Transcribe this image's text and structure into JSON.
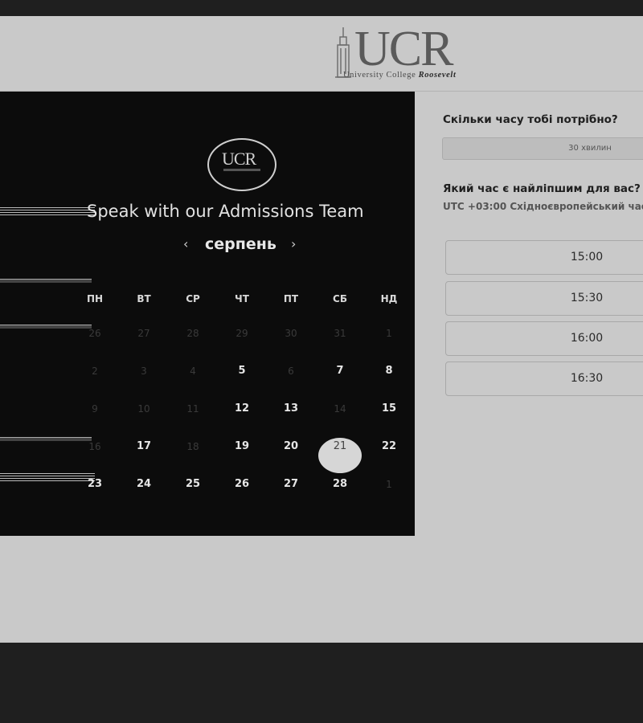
{
  "header": {
    "logo_text": "UCR",
    "logo_subtitle": "University College",
    "logo_subtitle_italic": "Roosevelt"
  },
  "scheduler": {
    "badge_text": "UCR",
    "title": "Speak with our Admissions Team",
    "month": "серпень",
    "prev_icon": "‹",
    "next_icon": "›",
    "weekdays": [
      "ПН",
      "ВТ",
      "СР",
      "ЧТ",
      "ПТ",
      "СБ",
      "НД"
    ],
    "weeks": [
      [
        {
          "d": "26",
          "a": false
        },
        {
          "d": "27",
          "a": false
        },
        {
          "d": "28",
          "a": false
        },
        {
          "d": "29",
          "a": false
        },
        {
          "d": "30",
          "a": false
        },
        {
          "d": "31",
          "a": false
        },
        {
          "d": "1",
          "a": false
        }
      ],
      [
        {
          "d": "2",
          "a": false
        },
        {
          "d": "3",
          "a": false
        },
        {
          "d": "4",
          "a": false
        },
        {
          "d": "5",
          "a": true
        },
        {
          "d": "6",
          "a": false
        },
        {
          "d": "7",
          "a": true
        },
        {
          "d": "8",
          "a": true
        }
      ],
      [
        {
          "d": "9",
          "a": false
        },
        {
          "d": "10",
          "a": false
        },
        {
          "d": "11",
          "a": false
        },
        {
          "d": "12",
          "a": true
        },
        {
          "d": "13",
          "a": true
        },
        {
          "d": "14",
          "a": false
        },
        {
          "d": "15",
          "a": true
        }
      ],
      [
        {
          "d": "16",
          "a": false
        },
        {
          "d": "17",
          "a": true
        },
        {
          "d": "18",
          "a": false
        },
        {
          "d": "19",
          "a": true
        },
        {
          "d": "20",
          "a": true
        },
        {
          "d": "21",
          "a": true,
          "selected": true
        },
        {
          "d": "22",
          "a": true
        }
      ],
      [
        {
          "d": "23",
          "a": true
        },
        {
          "d": "24",
          "a": true
        },
        {
          "d": "25",
          "a": true
        },
        {
          "d": "26",
          "a": true
        },
        {
          "d": "27",
          "a": true
        },
        {
          "d": "28",
          "a": true
        },
        {
          "d": "1",
          "a": false
        }
      ]
    ]
  },
  "booking": {
    "duration_question": "Скільки часу тобі потрібно?",
    "duration_value": "30 хвилин",
    "time_question": "Який час є найліпшим для вас?",
    "timezone": "UTC +03:00 Східноєвропейський час",
    "slots": [
      "15:00",
      "15:30",
      "16:00",
      "16:30"
    ]
  }
}
